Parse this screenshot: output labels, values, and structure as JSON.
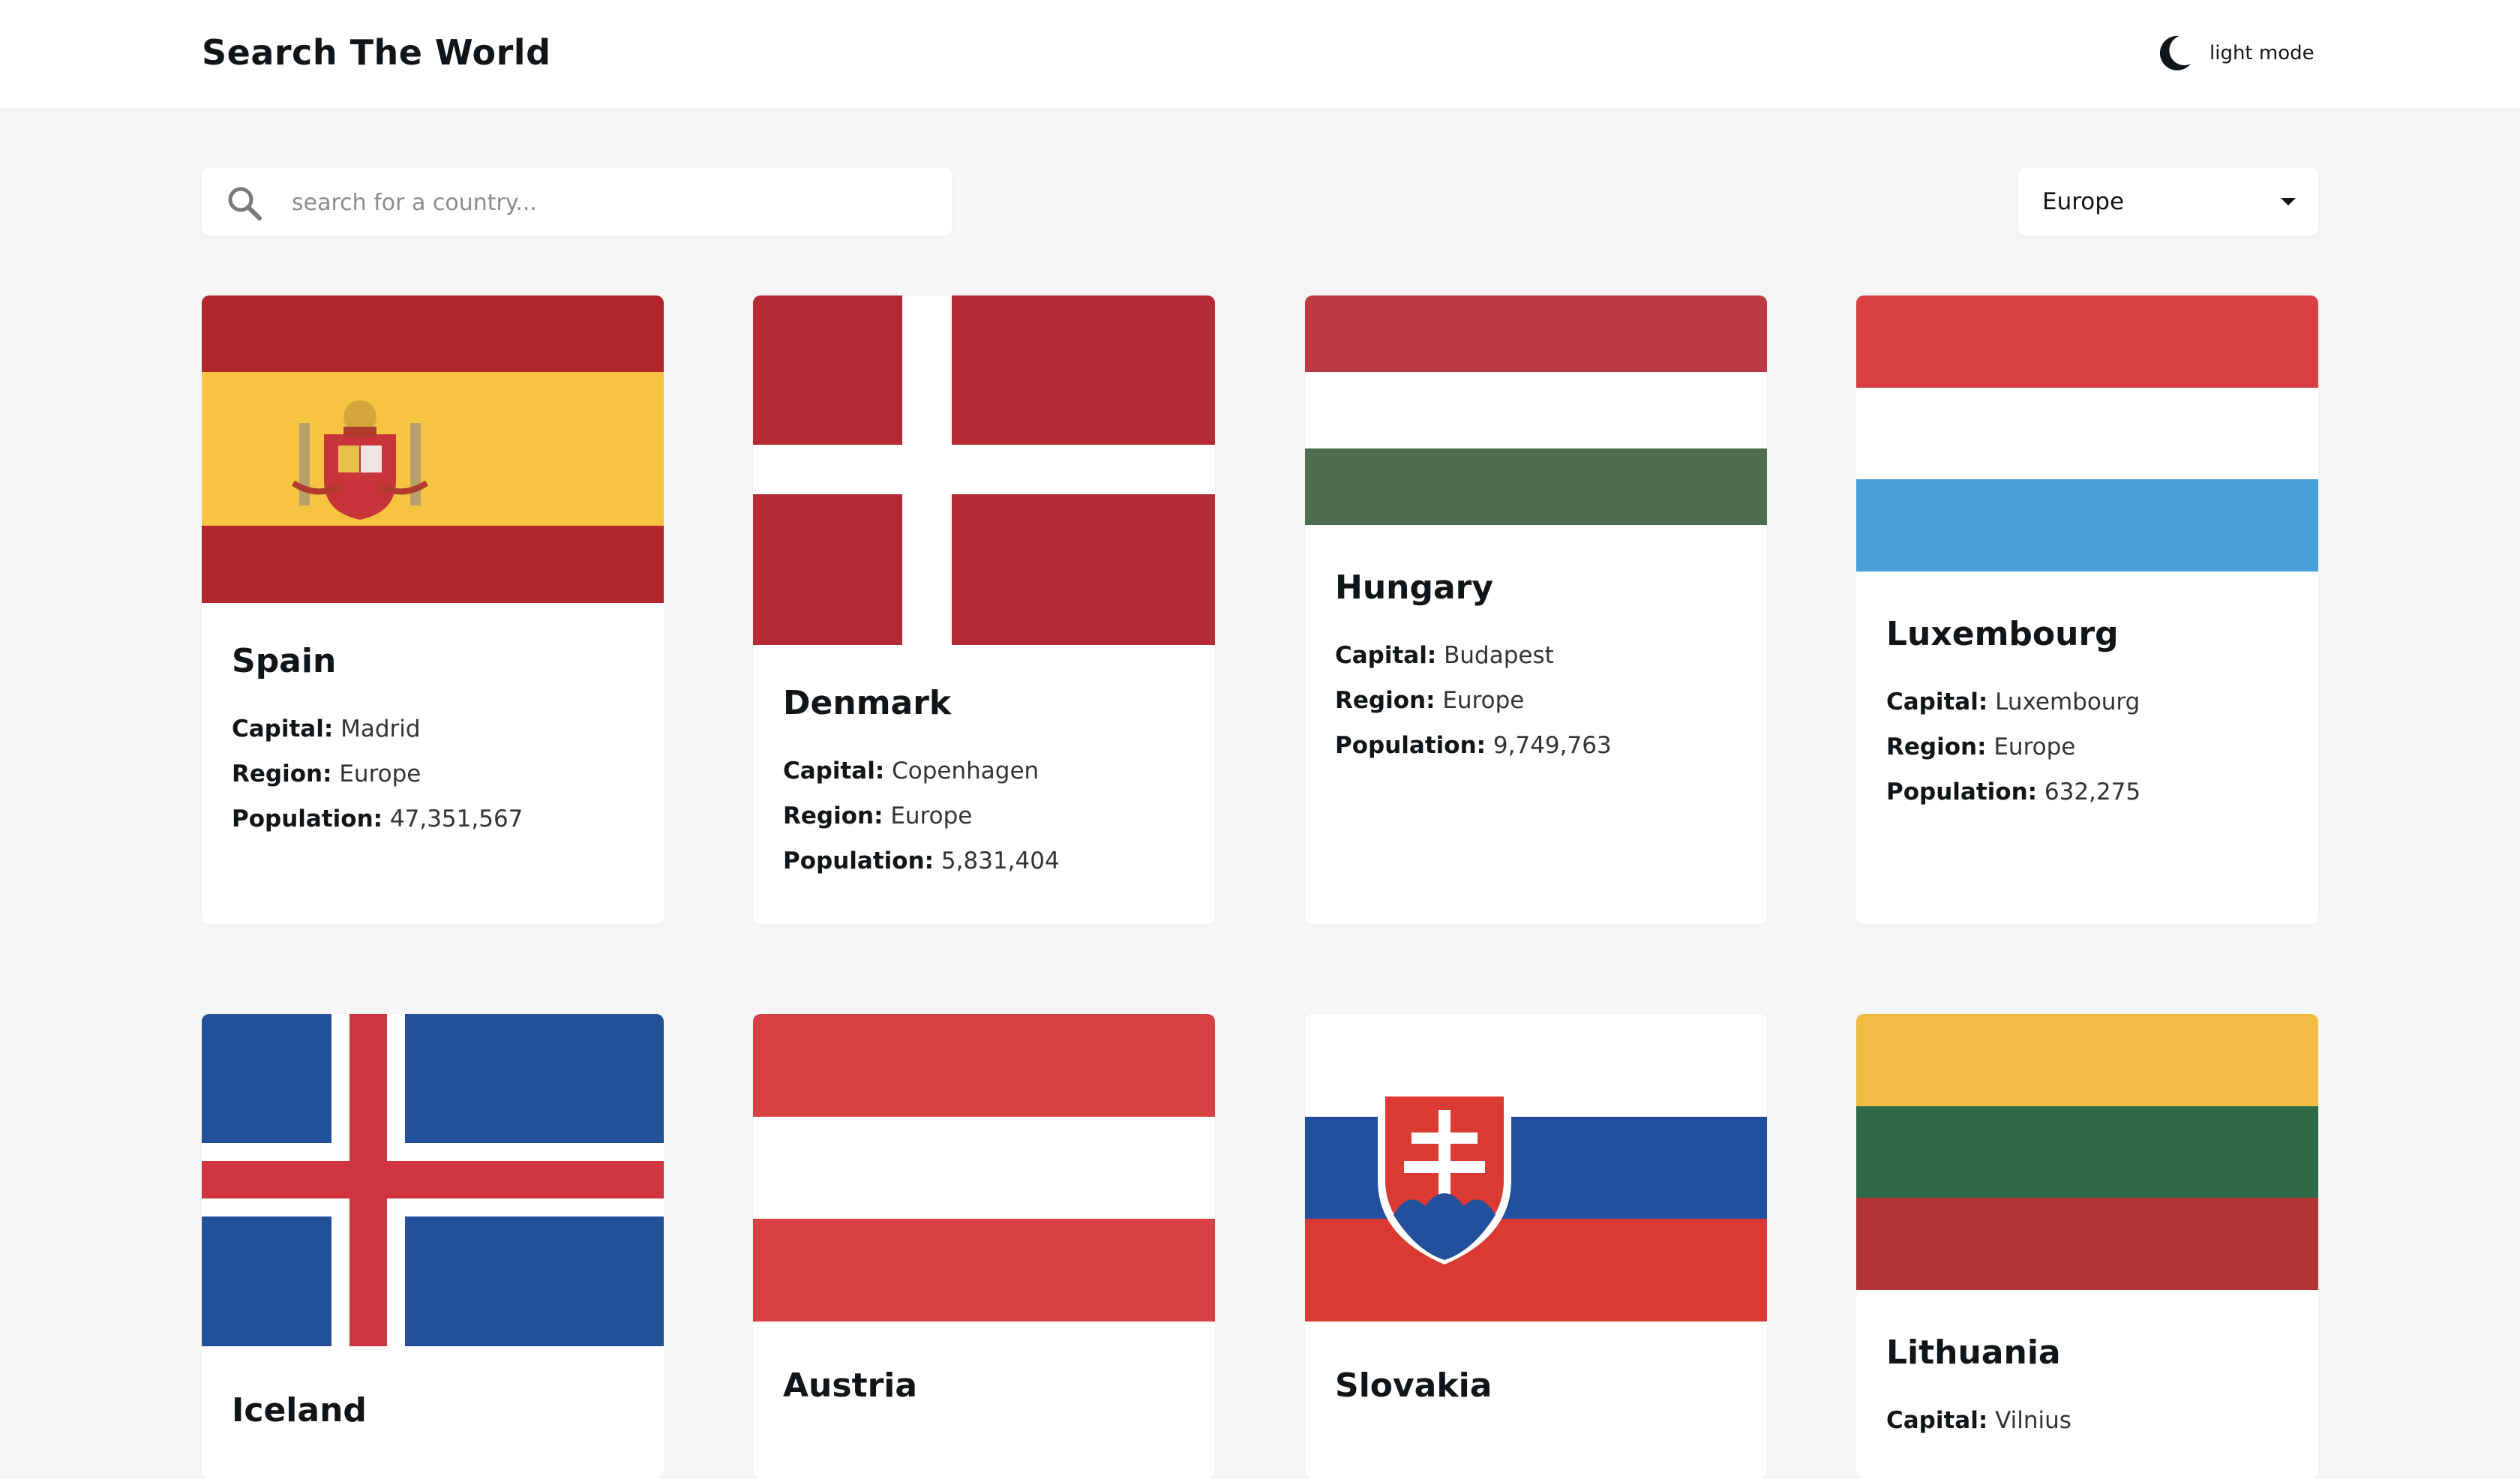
{
  "header": {
    "title": "Search The World",
    "theme_toggle_label": "light mode",
    "theme_icon": "moon-icon"
  },
  "search": {
    "placeholder": "search for a country...",
    "value": "",
    "icon": "search-icon"
  },
  "filter": {
    "selected": "Europe",
    "icon": "chevron-down-icon"
  },
  "labels": {
    "capital": "Capital:",
    "region": "Region:",
    "population": "Population:"
  },
  "countries": [
    {
      "name": "Spain",
      "capital": "Madrid",
      "region": "Europe",
      "population": "47,351,567"
    },
    {
      "name": "Denmark",
      "capital": "Copenhagen",
      "region": "Europe",
      "population": "5,831,404"
    },
    {
      "name": "Hungary",
      "capital": "Budapest",
      "region": "Europe",
      "population": "9,749,763"
    },
    {
      "name": "Luxembourg",
      "capital": "Luxembourg",
      "region": "Europe",
      "population": "632,275"
    },
    {
      "name": "Iceland",
      "capital": "",
      "region": "",
      "population": ""
    },
    {
      "name": "Austria",
      "capital": "",
      "region": "",
      "population": ""
    },
    {
      "name": "Slovakia",
      "capital": "",
      "region": "",
      "population": ""
    },
    {
      "name": "Lithuania",
      "capital": "Vilnius",
      "region": "",
      "population": ""
    }
  ],
  "colors": {
    "background": "#f6f6f6",
    "card": "#ffffff",
    "text": "#111517"
  }
}
